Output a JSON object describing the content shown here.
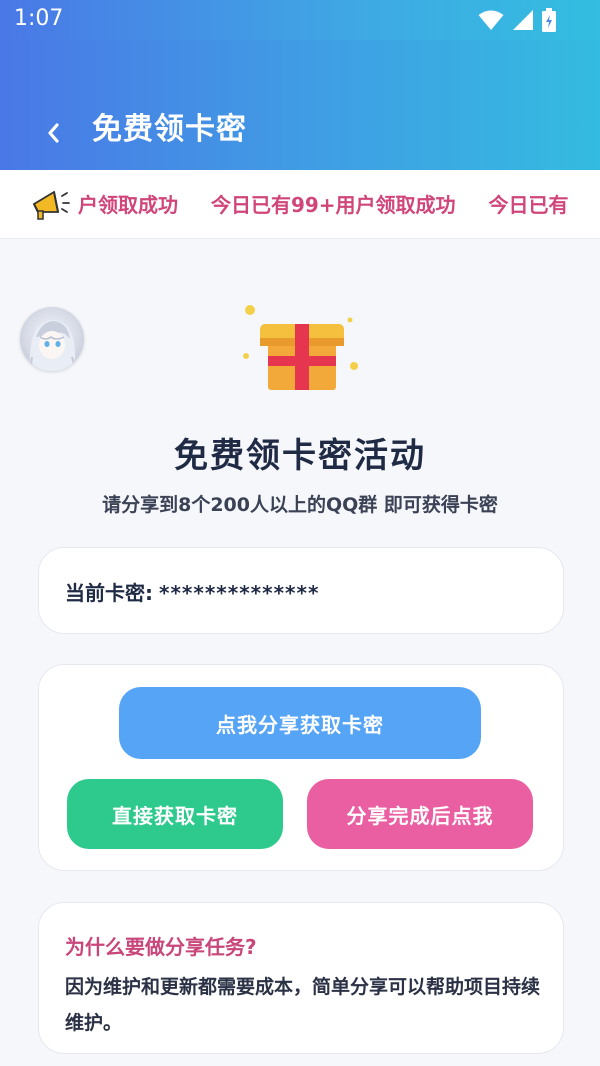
{
  "status_bar": {
    "time": "1:07"
  },
  "header": {
    "title": "免费领卡密"
  },
  "ticker": {
    "items": [
      "户领取成功",
      "今日已有99+用户领取成功",
      "今日已有"
    ]
  },
  "hero": {
    "title": "免费领卡密活动",
    "subtitle": "请分享到8个200人以上的QQ群 即可获得卡密"
  },
  "key_card": {
    "label": "当前卡密:",
    "value": "**************"
  },
  "actions": {
    "share_label": "点我分享获取卡密",
    "direct_label": "直接获取卡密",
    "done_label": "分享完成后点我"
  },
  "why": {
    "question": "为什么要做分享任务?",
    "answer": "因为维护和更新都需要成本，简单分享可以帮助项目持续维护。"
  },
  "colors": {
    "header_start": "#4a78e6",
    "header_end": "#34bbe0",
    "ticker_text": "#d0457a",
    "share_btn": "#56a4f5",
    "direct_btn": "#2ec98c",
    "done_btn": "#ea5fa1",
    "question": "#c8467a"
  },
  "icons": [
    "back-chevron-icon",
    "wifi-icon",
    "signal-icon",
    "battery-icon",
    "megaphone-icon",
    "gift-icon",
    "avatar"
  ]
}
